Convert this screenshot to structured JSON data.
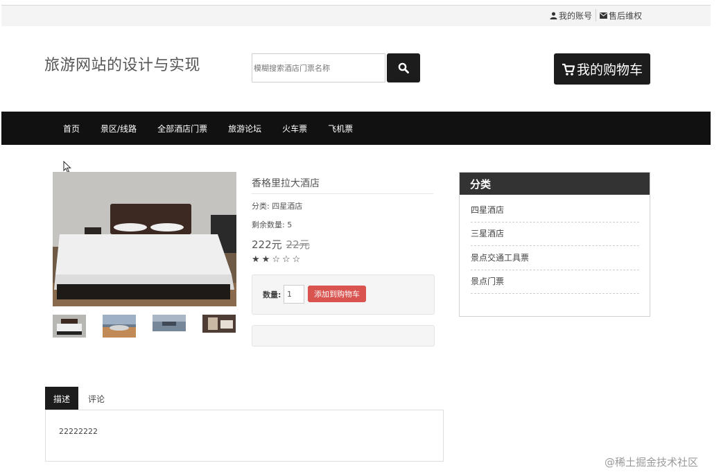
{
  "topbar": {
    "account_label": "我的账号",
    "service_label": "售后维权"
  },
  "header": {
    "site_title": "旅游网站的设计与实现",
    "search_placeholder": "模糊搜索酒店门票名称",
    "cart_label": "我的购物车"
  },
  "nav": {
    "items": [
      "首页",
      "景区/线路",
      "全部酒店门票",
      "旅游论坛",
      "火车票",
      "飞机票"
    ]
  },
  "product": {
    "name": "香格里拉大酒店",
    "category_text": "分类: 四星酒店",
    "stock_text": "剩余数量: 5",
    "price": "222元",
    "original_price": "22元",
    "rating": 2,
    "rating_max": 5,
    "quantity_label": "数量:",
    "quantity_value": "1",
    "add_to_cart_label": "添加到购物车"
  },
  "categories": {
    "title": "分类",
    "items": [
      "四星酒店",
      "三星酒店",
      "景点交通工具票",
      "景点门票"
    ]
  },
  "tabs": {
    "items": [
      "描述",
      "评论"
    ],
    "active": "描述",
    "description": "22222222"
  },
  "watermark": "@稀土掘金技术社区",
  "colors": {
    "nav_bg": "#111111",
    "button_dark": "#1c1c1c",
    "add_button": "#d9534f",
    "panel_header": "#333333"
  }
}
